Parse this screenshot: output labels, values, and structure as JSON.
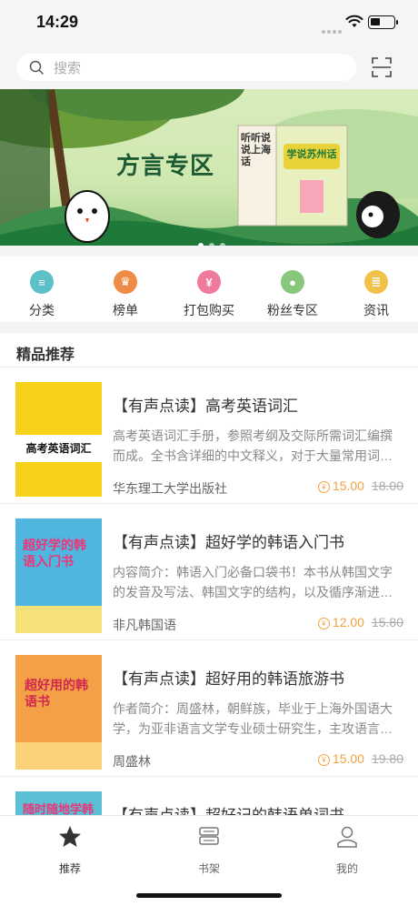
{
  "status": {
    "time": "14:29"
  },
  "search": {
    "placeholder": "搜索"
  },
  "banner": {
    "title": "方言专区",
    "book_title": "听听说说上海话",
    "book_sub": "学说苏州话"
  },
  "categories": [
    {
      "label": "分类",
      "color": "#5cc0c9",
      "glyph": "≡"
    },
    {
      "label": "榜单",
      "color": "#f08a47",
      "glyph": "♛"
    },
    {
      "label": "打包购买",
      "color": "#f07a9b",
      "glyph": "¥"
    },
    {
      "label": "粉丝专区",
      "color": "#89c77d",
      "glyph": "●"
    },
    {
      "label": "资讯",
      "color": "#f1c24a",
      "glyph": "≣"
    }
  ],
  "section": {
    "title": "精品推荐"
  },
  "books": [
    {
      "title": "【有声点读】高考英语词汇",
      "desc": "高考英语词汇手册，参照考纲及交际所需词汇编撰而成。全书含详细的中文释义，对于大量常用词…",
      "publisher": "华东理工大学出版社",
      "price": "15.00",
      "original": "18.00",
      "cover_text": "高考英语词汇",
      "cover_color": "#f6d21a"
    },
    {
      "title": "【有声点读】超好学的韩语入门书",
      "desc": "内容简介：韩语入门必备口袋书！本书从韩国文字的发音及写法、韩国文字的结构，以及循序渐进…",
      "publisher": "非凡韩国语",
      "price": "12.00",
      "original": "15.80",
      "cover_text": "超好学的韩语入门书",
      "cover_color": "#4fb6e0"
    },
    {
      "title": "【有声点读】超好用的韩语旅游书",
      "desc": "作者简介：周盛林，朝鲜族，毕业于上海外国语大学，为亚非语言文学专业硕士研究生，主攻语言…",
      "publisher": "周盛林",
      "price": "15.00",
      "original": "19.80",
      "cover_text": "超好用的韩语书",
      "cover_color": "#f3a046"
    },
    {
      "title": "【有声点读】超好记的韩语单词书",
      "desc": "",
      "publisher": "",
      "price": "",
      "original": "",
      "cover_text": "随时随地学韩语",
      "cover_color": "#5bc0d6"
    }
  ],
  "tabs": [
    {
      "label": "推荐",
      "icon": "star-icon",
      "active": true
    },
    {
      "label": "书架",
      "icon": "bookshelf-icon",
      "active": false
    },
    {
      "label": "我的",
      "icon": "profile-icon",
      "active": false
    }
  ]
}
